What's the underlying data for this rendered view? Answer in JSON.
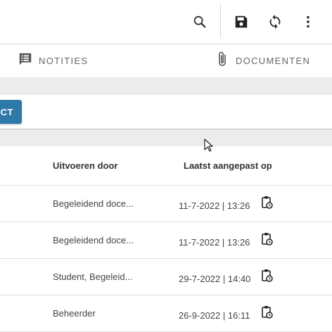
{
  "toolbar": {
    "icons": [
      "search-icon",
      "save-icon",
      "sync-icon",
      "more-vert-icon"
    ]
  },
  "tabs": [
    {
      "label": "NOTITIES",
      "icon": "notes-icon"
    },
    {
      "label": "DOCUMENTEN",
      "icon": "paperclip-icon"
    }
  ],
  "panel": {
    "button_label": "CT"
  },
  "table": {
    "headers": {
      "performed_by": "Uitvoeren door",
      "last_modified": "Laatst aangepast op"
    },
    "rows": [
      {
        "performed_by": "Begeleidend doce...",
        "last_modified": "11-7-2022 | 13:26"
      },
      {
        "performed_by": "Begeleidend doce...",
        "last_modified": "11-7-2022 | 13:26"
      },
      {
        "performed_by": "Student, Begeleid...",
        "last_modified": "29-7-2022 | 14:40"
      },
      {
        "performed_by": "Beheerder",
        "last_modified": "26-9-2022 | 16:11"
      }
    ]
  },
  "colors": {
    "accent_button": "#2f79a8",
    "band": "#ececec",
    "icon": "#333333"
  }
}
